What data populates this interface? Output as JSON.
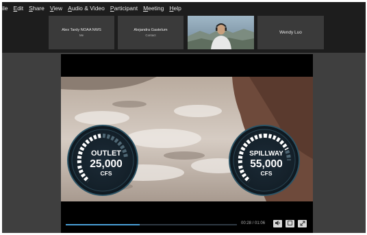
{
  "menubar": {
    "items": [
      {
        "label": "ile",
        "accent_index": -1
      },
      {
        "label": "Edit",
        "accent_index": 0
      },
      {
        "label": "Share",
        "accent_index": 0
      },
      {
        "label": "View",
        "accent_index": 0
      },
      {
        "label": "Audio & Video",
        "accent_index": 0
      },
      {
        "label": "Participant",
        "accent_index": 0
      },
      {
        "label": "Meeting",
        "accent_index": 0
      },
      {
        "label": "Help",
        "accent_index": 0
      }
    ]
  },
  "participants": [
    {
      "name": "Alex Tardy NOAA NWS",
      "subtitle": "Me"
    },
    {
      "name": "Alejandra Gastelum",
      "subtitle": "Contact"
    },
    {
      "name": "",
      "subtitle": "",
      "has_video": true
    },
    {
      "name": "Wendy Luo",
      "subtitle": ""
    }
  ],
  "video": {
    "gauges": [
      {
        "label": "OUTLET",
        "value": "25,000",
        "unit": "CFS"
      },
      {
        "label": "SPILLWAY",
        "value": "55,000",
        "unit": "CFS"
      }
    ]
  },
  "player": {
    "progress": 0.43,
    "timecode": "00:28 / 01:06",
    "buttons": [
      "volume-icon",
      "fullscreen-exit-icon",
      "expand-icon"
    ]
  },
  "colors": {
    "menubar_bg": "#1d1d1d",
    "app_bg": "#3f3f3f",
    "tile_bg": "#3a3a3a",
    "gauge_accent": "#ffffff",
    "progress": "#4aa0d8"
  }
}
